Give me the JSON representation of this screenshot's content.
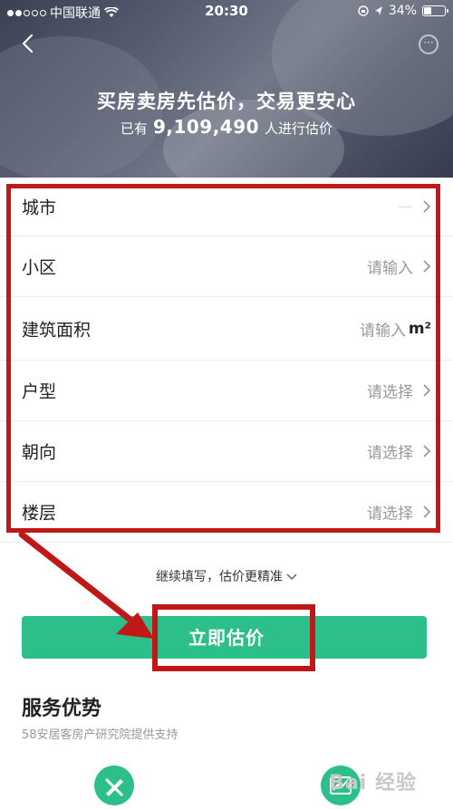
{
  "status_bar": {
    "carrier": "中国联通",
    "time": "20:30",
    "battery": "34%"
  },
  "hero": {
    "title": "买房卖房先估价，交易更安心",
    "sub_prefix": "已有",
    "count": "9,109,490",
    "sub_suffix": "人进行估价"
  },
  "form": {
    "rows": [
      {
        "label": "城市",
        "value": "—"
      },
      {
        "label": "小区",
        "value": "请输入"
      },
      {
        "label": "建筑面积",
        "value": "请输入",
        "unit": "m²"
      },
      {
        "label": "户型",
        "value": "请选择"
      },
      {
        "label": "朝向",
        "value": "请选择"
      },
      {
        "label": "楼层",
        "value": "请选择"
      }
    ]
  },
  "more_fill_label": "继续填写，估价更精准",
  "cta_label": "立即估价",
  "service": {
    "title": "服务优势",
    "subtitle": "58安居客房产研究院提供支持"
  },
  "watermark": "Bai 经验",
  "colors": {
    "accent_green": "#2dbf8a",
    "highlight_red": "#c01818"
  }
}
